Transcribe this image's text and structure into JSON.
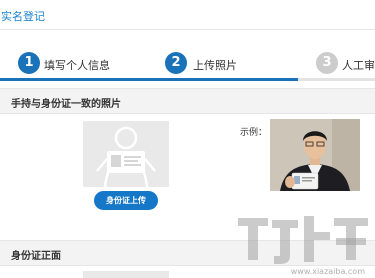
{
  "header": {
    "title": "实名登记"
  },
  "steps": [
    {
      "number": "1",
      "label": "填写个人信息",
      "state": "done"
    },
    {
      "number": "2",
      "label": "上传照片",
      "state": "current"
    },
    {
      "number": "3",
      "label": "人工审核",
      "state": "pending"
    }
  ],
  "colors": {
    "accent": "#1a72b8",
    "button": "#1477c7",
    "inactive": "#cccccc"
  },
  "section_handheld": {
    "heading": "手持与身份证一致的照片",
    "upload_button": "身份证上传",
    "example_label": "示例："
  },
  "section_front": {
    "heading": "身份证正面"
  },
  "watermark": {
    "text": "www.xiazaiba.com"
  }
}
